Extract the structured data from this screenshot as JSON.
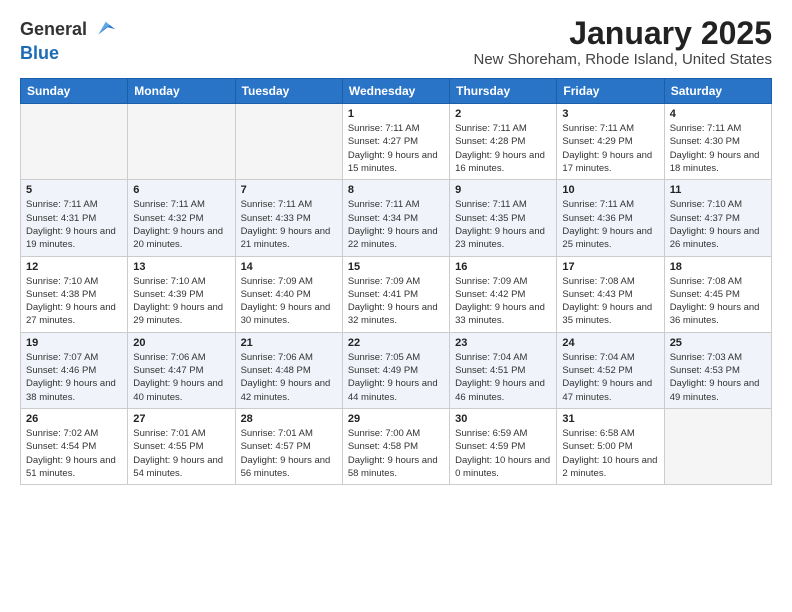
{
  "logo": {
    "general": "General",
    "blue": "Blue"
  },
  "header": {
    "title": "January 2025",
    "subtitle": "New Shoreham, Rhode Island, United States"
  },
  "weekdays": [
    "Sunday",
    "Monday",
    "Tuesday",
    "Wednesday",
    "Thursday",
    "Friday",
    "Saturday"
  ],
  "weeks": [
    [
      {
        "day": "",
        "sunrise": "",
        "sunset": "",
        "daylight": ""
      },
      {
        "day": "",
        "sunrise": "",
        "sunset": "",
        "daylight": ""
      },
      {
        "day": "",
        "sunrise": "",
        "sunset": "",
        "daylight": ""
      },
      {
        "day": "1",
        "sunrise": "7:11 AM",
        "sunset": "4:27 PM",
        "daylight": "9 hours and 15 minutes."
      },
      {
        "day": "2",
        "sunrise": "7:11 AM",
        "sunset": "4:28 PM",
        "daylight": "9 hours and 16 minutes."
      },
      {
        "day": "3",
        "sunrise": "7:11 AM",
        "sunset": "4:29 PM",
        "daylight": "9 hours and 17 minutes."
      },
      {
        "day": "4",
        "sunrise": "7:11 AM",
        "sunset": "4:30 PM",
        "daylight": "9 hours and 18 minutes."
      }
    ],
    [
      {
        "day": "5",
        "sunrise": "7:11 AM",
        "sunset": "4:31 PM",
        "daylight": "9 hours and 19 minutes."
      },
      {
        "day": "6",
        "sunrise": "7:11 AM",
        "sunset": "4:32 PM",
        "daylight": "9 hours and 20 minutes."
      },
      {
        "day": "7",
        "sunrise": "7:11 AM",
        "sunset": "4:33 PM",
        "daylight": "9 hours and 21 minutes."
      },
      {
        "day": "8",
        "sunrise": "7:11 AM",
        "sunset": "4:34 PM",
        "daylight": "9 hours and 22 minutes."
      },
      {
        "day": "9",
        "sunrise": "7:11 AM",
        "sunset": "4:35 PM",
        "daylight": "9 hours and 23 minutes."
      },
      {
        "day": "10",
        "sunrise": "7:11 AM",
        "sunset": "4:36 PM",
        "daylight": "9 hours and 25 minutes."
      },
      {
        "day": "11",
        "sunrise": "7:10 AM",
        "sunset": "4:37 PM",
        "daylight": "9 hours and 26 minutes."
      }
    ],
    [
      {
        "day": "12",
        "sunrise": "7:10 AM",
        "sunset": "4:38 PM",
        "daylight": "9 hours and 27 minutes."
      },
      {
        "day": "13",
        "sunrise": "7:10 AM",
        "sunset": "4:39 PM",
        "daylight": "9 hours and 29 minutes."
      },
      {
        "day": "14",
        "sunrise": "7:09 AM",
        "sunset": "4:40 PM",
        "daylight": "9 hours and 30 minutes."
      },
      {
        "day": "15",
        "sunrise": "7:09 AM",
        "sunset": "4:41 PM",
        "daylight": "9 hours and 32 minutes."
      },
      {
        "day": "16",
        "sunrise": "7:09 AM",
        "sunset": "4:42 PM",
        "daylight": "9 hours and 33 minutes."
      },
      {
        "day": "17",
        "sunrise": "7:08 AM",
        "sunset": "4:43 PM",
        "daylight": "9 hours and 35 minutes."
      },
      {
        "day": "18",
        "sunrise": "7:08 AM",
        "sunset": "4:45 PM",
        "daylight": "9 hours and 36 minutes."
      }
    ],
    [
      {
        "day": "19",
        "sunrise": "7:07 AM",
        "sunset": "4:46 PM",
        "daylight": "9 hours and 38 minutes."
      },
      {
        "day": "20",
        "sunrise": "7:06 AM",
        "sunset": "4:47 PM",
        "daylight": "9 hours and 40 minutes."
      },
      {
        "day": "21",
        "sunrise": "7:06 AM",
        "sunset": "4:48 PM",
        "daylight": "9 hours and 42 minutes."
      },
      {
        "day": "22",
        "sunrise": "7:05 AM",
        "sunset": "4:49 PM",
        "daylight": "9 hours and 44 minutes."
      },
      {
        "day": "23",
        "sunrise": "7:04 AM",
        "sunset": "4:51 PM",
        "daylight": "9 hours and 46 minutes."
      },
      {
        "day": "24",
        "sunrise": "7:04 AM",
        "sunset": "4:52 PM",
        "daylight": "9 hours and 47 minutes."
      },
      {
        "day": "25",
        "sunrise": "7:03 AM",
        "sunset": "4:53 PM",
        "daylight": "9 hours and 49 minutes."
      }
    ],
    [
      {
        "day": "26",
        "sunrise": "7:02 AM",
        "sunset": "4:54 PM",
        "daylight": "9 hours and 51 minutes."
      },
      {
        "day": "27",
        "sunrise": "7:01 AM",
        "sunset": "4:55 PM",
        "daylight": "9 hours and 54 minutes."
      },
      {
        "day": "28",
        "sunrise": "7:01 AM",
        "sunset": "4:57 PM",
        "daylight": "9 hours and 56 minutes."
      },
      {
        "day": "29",
        "sunrise": "7:00 AM",
        "sunset": "4:58 PM",
        "daylight": "9 hours and 58 minutes."
      },
      {
        "day": "30",
        "sunrise": "6:59 AM",
        "sunset": "4:59 PM",
        "daylight": "10 hours and 0 minutes."
      },
      {
        "day": "31",
        "sunrise": "6:58 AM",
        "sunset": "5:00 PM",
        "daylight": "10 hours and 2 minutes."
      },
      {
        "day": "",
        "sunrise": "",
        "sunset": "",
        "daylight": ""
      }
    ]
  ]
}
